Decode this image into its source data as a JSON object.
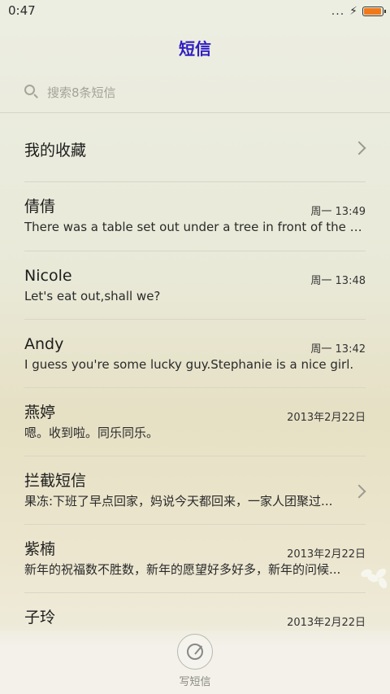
{
  "status_bar": {
    "time": "0:47",
    "signal_dots": "...",
    "charging_symbol": "⚡",
    "battery_level": 0.95,
    "battery_color": "#f07a1a"
  },
  "header": {
    "title": "短信",
    "title_color": "#2f1ec4"
  },
  "search": {
    "placeholder": "搜索8条短信"
  },
  "favorites": {
    "label": "我的收藏"
  },
  "conversations": [
    {
      "name": "倩倩",
      "time": "周一 13:49",
      "preview": "There was a table set out under a tree in front of the ho..."
    },
    {
      "name": "Nicole",
      "time": "周一 13:48",
      "preview": "Let's eat out,shall we?"
    },
    {
      "name": "Andy",
      "time": "周一 13:42",
      "preview": "I guess you're some lucky guy.Stephanie is a nice girl."
    },
    {
      "name": "燕婷",
      "time": "2013年2月22日",
      "preview": "嗯。收到啦。同乐同乐。"
    },
    {
      "name": "拦截短信",
      "time": "",
      "preview": "果冻:下班了早点回家，妈说今天都回来，一家人团聚过..."
    },
    {
      "name": "紫楠",
      "time": "2013年2月22日",
      "preview": "新年的祝福数不胜数，新年的愿望好多好多，新年的问候..."
    },
    {
      "name": "子玲",
      "time": "2013年2月22日",
      "preview": ""
    }
  ],
  "compose": {
    "label": "写短信",
    "icon": "compose-icon"
  }
}
